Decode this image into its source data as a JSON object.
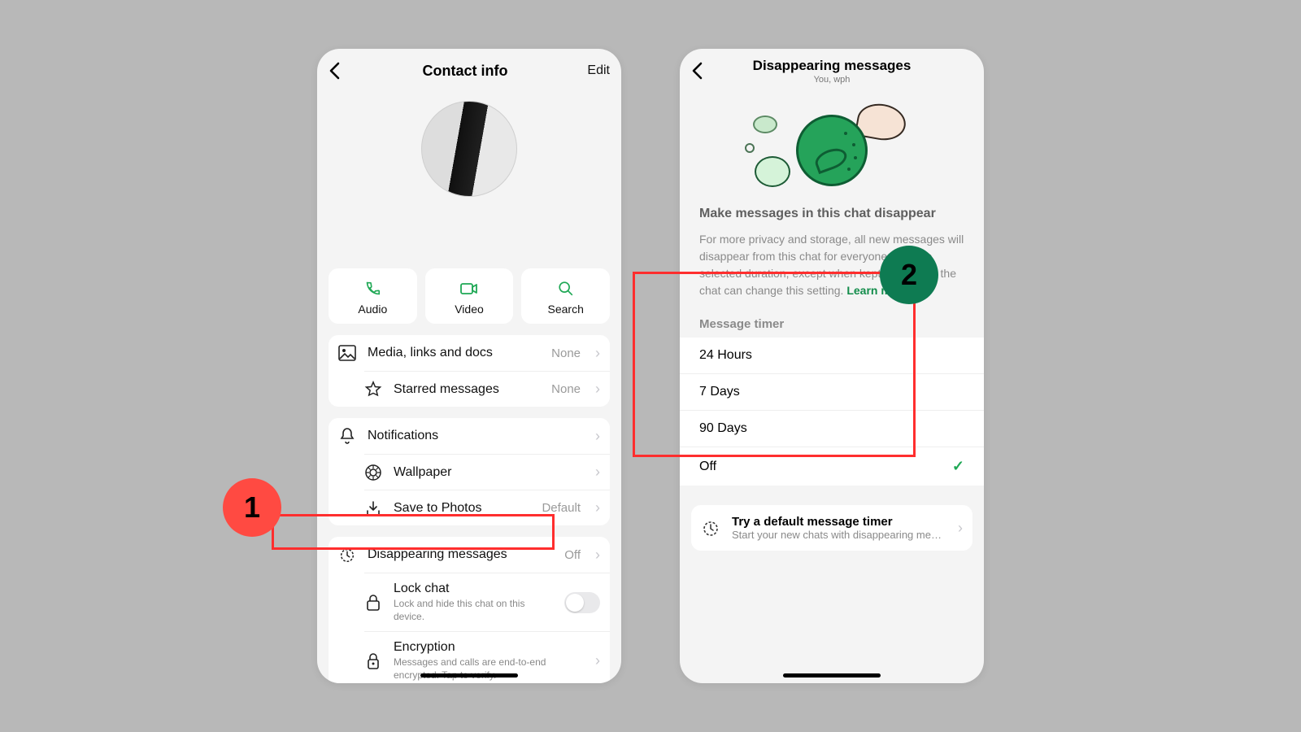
{
  "left": {
    "header": {
      "title": "Contact info",
      "edit": "Edit"
    },
    "actions": [
      {
        "label": "Audio"
      },
      {
        "label": "Video"
      },
      {
        "label": "Search"
      }
    ],
    "media": {
      "media_links_docs": {
        "label": "Media, links and docs",
        "value": "None"
      },
      "starred": {
        "label": "Starred messages",
        "value": "None"
      }
    },
    "settings": {
      "notifications": {
        "label": "Notifications"
      },
      "wallpaper": {
        "label": "Wallpaper"
      },
      "save_photos": {
        "label": "Save to Photos",
        "value": "Default"
      }
    },
    "privacy": {
      "disappearing": {
        "label": "Disappearing messages",
        "value": "Off"
      },
      "lock": {
        "label": "Lock chat",
        "sub": "Lock and hide this chat on this device."
      },
      "encryption": {
        "label": "Encryption",
        "sub": "Messages and calls are end-to-end encrypted. Tap to verify."
      }
    }
  },
  "right": {
    "header": {
      "title": "Disappearing messages",
      "sub": "You, wph"
    },
    "heading": "Make messages in this chat disappear",
    "paragraph": "For more privacy and storage, all new messages will disappear from this chat for everyone after the selected duration, except when kept. Anyone in the chat can change this setting. ",
    "learn_more": "Learn more",
    "section": "Message timer",
    "options": [
      "24 Hours",
      "7 Days",
      "90 Days",
      "Off"
    ],
    "selected_index": 3,
    "footer": {
      "title": "Try a default message timer",
      "sub": "Start your new chats with disappearing mess…"
    }
  },
  "annotations": {
    "one": "1",
    "two": "2"
  }
}
